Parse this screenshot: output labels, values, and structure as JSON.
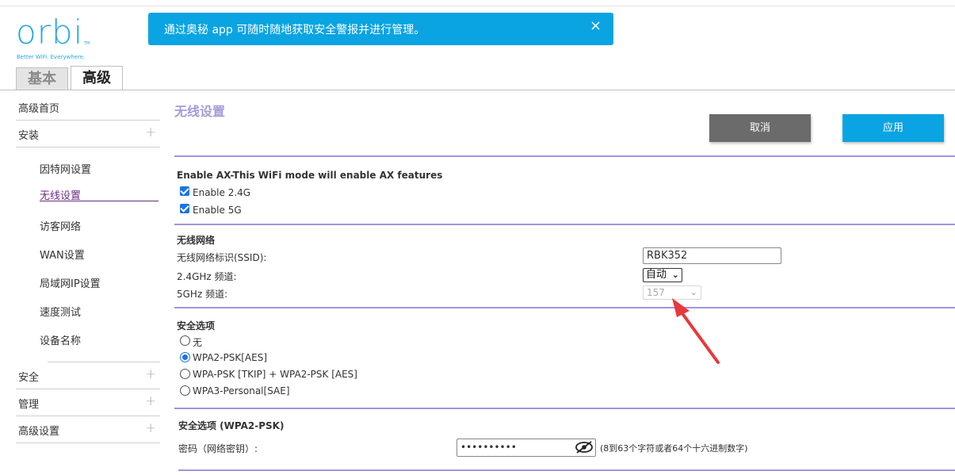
{
  "brand": {
    "logo": "orbi",
    "tm": "TM",
    "tagline": "Better WiFi. Everywhere."
  },
  "banner": {
    "text": "通过奥秘 app 可随时随地获取安全警报并进行管理。",
    "close": "×"
  },
  "tabs": [
    {
      "label": "基本"
    },
    {
      "label": "高级"
    }
  ],
  "sidebar": {
    "home": "高级首页",
    "install": "安装",
    "install_items": [
      "因特网设置",
      "无线设置",
      "访客网络",
      "WAN设置",
      "局域网IP设置",
      "速度测试",
      "设备名称"
    ],
    "security": "安全",
    "manage": "管理",
    "advanced": "高级设置",
    "expand": "+"
  },
  "page": {
    "title": "无线设置"
  },
  "buttons": {
    "cancel": "取消",
    "apply": "应用"
  },
  "ax": {
    "title": "Enable AX-This WiFi mode will enable AX features",
    "enable24": "Enable 2.4G",
    "enable5": "Enable 5G"
  },
  "network": {
    "title": "无线网络",
    "ssid_label": "无线网络标识(SSID):",
    "ssid_value": "RBK352",
    "ch24_label": "2.4GHz 频道:",
    "ch24_value": "自动",
    "ch5_label": "5GHz 频道:",
    "ch5_value": "157"
  },
  "security": {
    "title": "安全选项",
    "options": [
      "无",
      "WPA2-PSK[AES]",
      "WPA-PSK [TKIP] + WPA2-PSK [AES]",
      "WPA3-Personal[SAE]"
    ],
    "selected": "WPA2-PSK[AES]"
  },
  "wpa": {
    "title": "安全选项 (WPA2-PSK)",
    "pwd_label": "密码（网络密钥）:",
    "pwd_value": "••••••••••",
    "hint": "(8到63个字符或者64个十六进制数字)"
  },
  "colors": {
    "accent": "#0aa4e2",
    "purple": "#6a2b82",
    "rule": "#9d96df",
    "title": "#a49bd8",
    "arrow": "#e8383b"
  }
}
